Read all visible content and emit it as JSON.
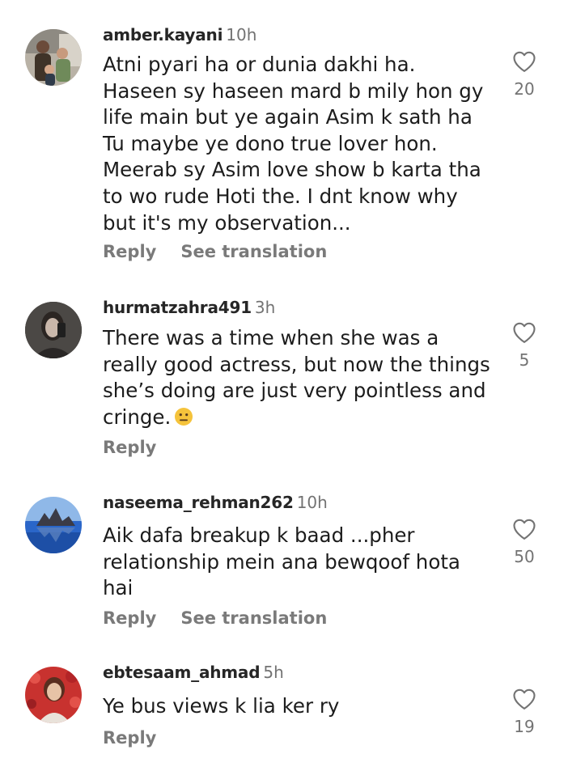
{
  "comments": [
    {
      "username": "amber.kayani",
      "time": "10h",
      "text": "Atni pyari ha or dunia dakhi ha. Haseen sy haseen mard b mily hon gy life main but ye again Asim k sath ha Tu maybe ye dono true lover hon. Meerab sy Asim love show b karta tha to wo rude Hoti the.  I dnt know why but it's my observation...",
      "reply_label": "Reply",
      "translation_label": "See translation",
      "likes": "20"
    },
    {
      "username": "hurmatzahra491",
      "time": "3h",
      "text": "There was a time when she was a really good actress, but now the things she’s doing are just very pointless and cringe.",
      "emoji_icon": "neutral-face-emoji",
      "reply_label": "Reply",
      "likes": "5"
    },
    {
      "username": "naseema_rehman262",
      "time": "10h",
      "text": "Aik dafa breakup k baad ...pher relationship mein ana bewqoof hota hai",
      "reply_label": "Reply",
      "translation_label": "See translation",
      "likes": "50"
    },
    {
      "username": "ebtesaam_ahmad",
      "time": "5h",
      "text": "Ye bus views k lia ker ry",
      "reply_label": "Reply",
      "likes": "19"
    }
  ],
  "icons": {
    "like": "heart-outline-icon"
  },
  "colors": {
    "username": "#262626",
    "meta": "#737373",
    "text": "#1c1c1c"
  }
}
